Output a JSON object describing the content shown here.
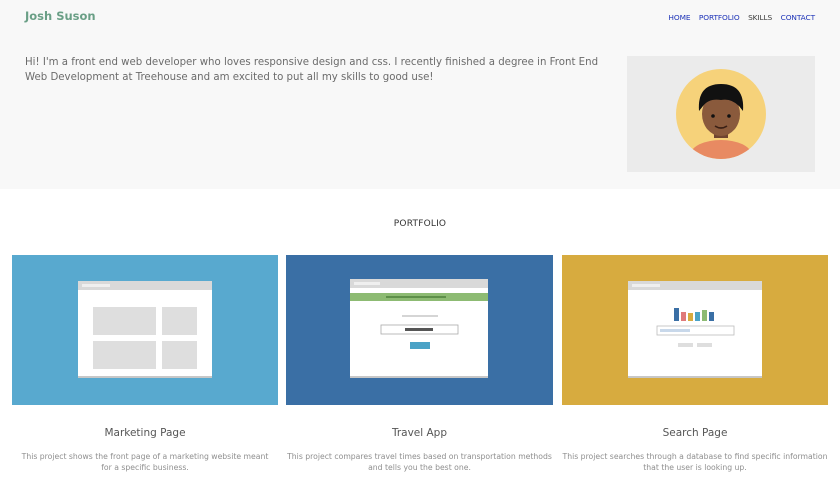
{
  "header": {
    "brand": "Josh Suson",
    "nav": [
      {
        "label": "HOME"
      },
      {
        "label": "PORTFOLIO"
      },
      {
        "label": "SKILLS"
      },
      {
        "label": "CONTACT"
      }
    ]
  },
  "intro": {
    "text": "Hi! I'm a front end web developer who loves responsive design and css. I recently finished a degree in Front End Web Development at Treehouse and am excited to put all my skills to good use!"
  },
  "portfolio": {
    "heading": "PORTFOLIO",
    "projects": [
      {
        "title": "Marketing Page",
        "description": "This project shows the front page of a marketing website meant for a specific business.",
        "color": "#58a9cf"
      },
      {
        "title": "Travel App",
        "description": "This project compares travel times based on transportation methods and tells you the best one.",
        "color": "#3a6fa5"
      },
      {
        "title": "Search Page",
        "description": "This project searches through a database to find specific information that the user is looking up.",
        "color": "#d7ab3f"
      }
    ]
  },
  "colors": {
    "brand": "#6a9f86",
    "nav_link": "#1d33b8",
    "avatar_bg": "#f6d27a",
    "skin": "#8a5a3c",
    "shirt": "#e88a62"
  }
}
